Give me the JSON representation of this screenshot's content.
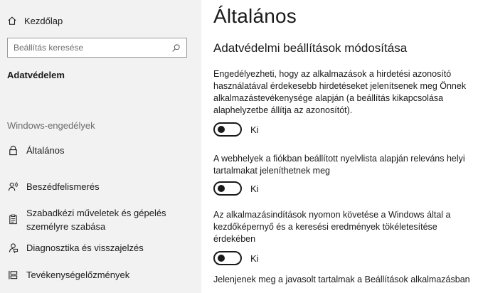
{
  "sidebar": {
    "home_label": "Kezdőlap",
    "search_placeholder": "Beállítás keresése",
    "category": "Adatvédelem",
    "section_label": "Windows-engedélyek",
    "items": [
      {
        "label": "Általános",
        "icon": "lock-icon"
      },
      {
        "label": "Beszédfelismerés",
        "icon": "speech-icon"
      },
      {
        "label_line1": "Szabadkézi műveletek és gépelés",
        "label_line2": "személyre szabása",
        "icon": "clipboard-icon"
      },
      {
        "label": "Diagnosztika és visszajelzés",
        "icon": "feedback-icon"
      },
      {
        "label": "Tevékenységelőzmények",
        "icon": "timeline-icon"
      }
    ]
  },
  "main": {
    "title": "Általános",
    "subtitle": "Adatvédelmi beállítások módosítása",
    "settings": [
      {
        "lines": [
          "Engedélyezheti, hogy az alkalmazások a hirdetési azonosító",
          "használatával érdekesebb hirdetéseket jelenítsenek meg Önnek",
          "alkalmazástevékenysége alapján (a beállítás kikapcsolása",
          "alaphelyzetbe állítja az azonosítót)."
        ],
        "state": "Ki",
        "on": false
      },
      {
        "lines": [
          "A webhelyek a fiókban beállított nyelvlista alapján releváns helyi",
          "tartalmakat jeleníthetnek meg"
        ],
        "state": "Ki",
        "on": false
      },
      {
        "lines": [
          "Az alkalmazásindítások nyomon követése a Windows által a",
          "kezdőképernyő és a keresési eredmények tökéletesítése",
          "érdekében"
        ],
        "state": "Ki",
        "on": false
      },
      {
        "lines": [
          "Jelenjenek meg a javasolt tartalmak a Beállítások alkalmazásban"
        ]
      }
    ]
  },
  "colors": {
    "sidebar_bg": "#f2f2f2",
    "main_bg": "#ffffff",
    "text": "#1a1a1a",
    "muted_text": "#6a6a6a"
  }
}
